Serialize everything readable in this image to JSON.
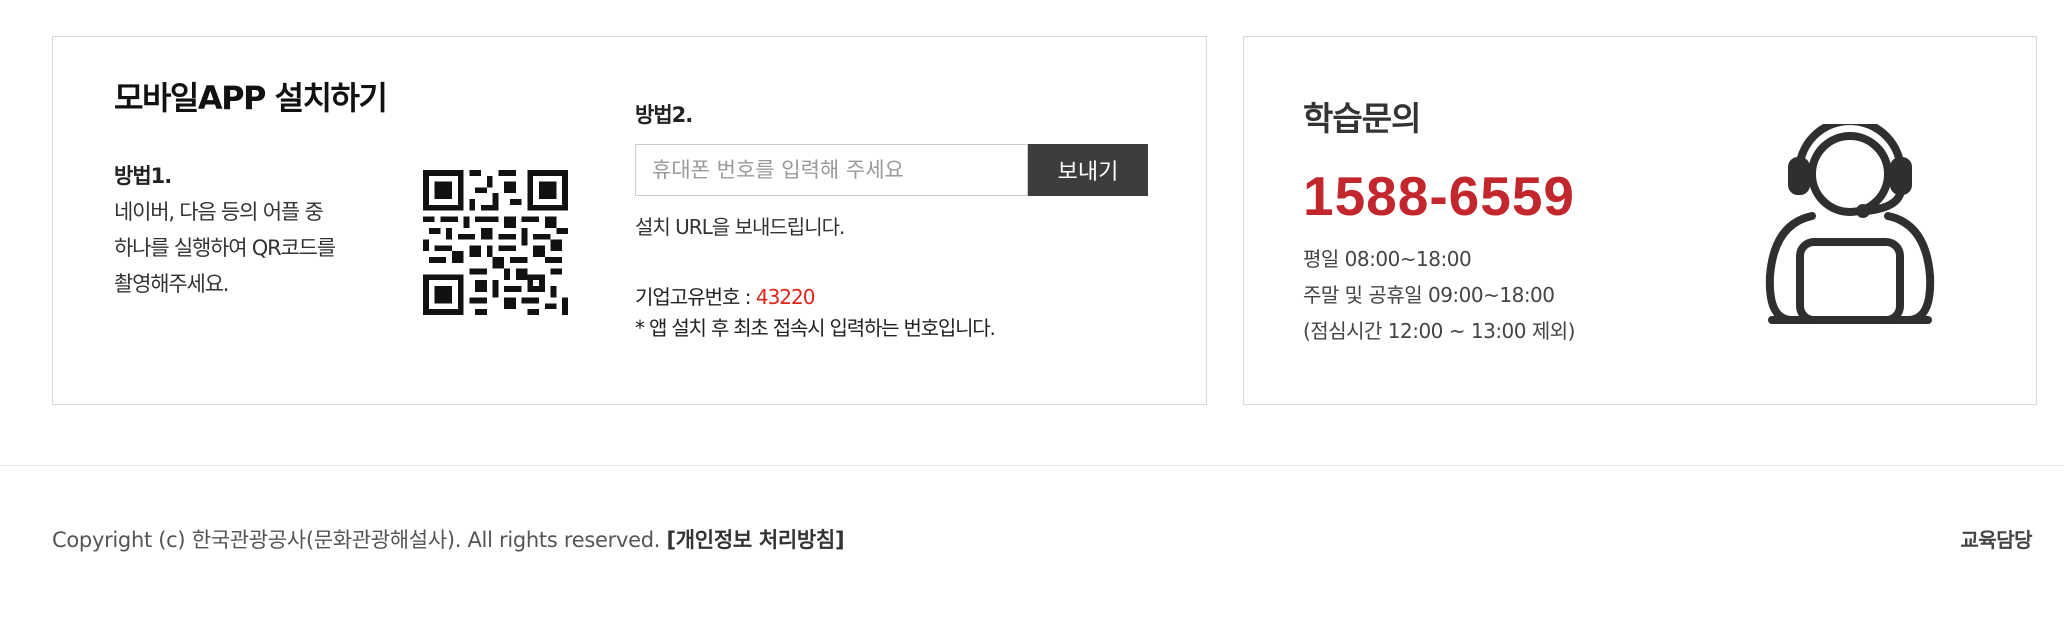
{
  "app_section": {
    "title": "모바일APP 설치하기",
    "method1": {
      "heading": "방법1.",
      "lines": [
        "네이버, 다음 등의 어플 중",
        "하나를 실행하여 QR코드를",
        "촬영해주세요."
      ]
    },
    "qr_icon": "qr-code",
    "method2": {
      "heading": "방법2.",
      "input_placeholder": "휴대폰 번호를 입력해 주세요",
      "input_value": "",
      "send_label": "보내기",
      "info": "설치 URL을 보내드립니다."
    },
    "corp_label": "기업고유번호 : ",
    "corp_number": "43220",
    "corp_note": "* 앱 설치 후 최초 접속시 입력하는 번호입니다."
  },
  "contact_section": {
    "title": "학습문의",
    "phone": "1588-6559",
    "hours": [
      "평일  08:00~18:00",
      "주말 및 공휴일  09:00~18:00",
      "(점심시간 12:00 ~ 13:00 제외)"
    ],
    "icon": "headset-support-icon"
  },
  "footer": {
    "copyright": "Copyright (c) 한국관광공사(문화관광해설사). All rights reserved. ",
    "policy_link": "[개인정보 처리방침]",
    "edu_link": "교육담당"
  },
  "colors": {
    "accent_red": "#c1272d",
    "corp_number_red": "#e1251b",
    "button_dark": "#3d3d3d",
    "border": "#d9d9d9"
  }
}
